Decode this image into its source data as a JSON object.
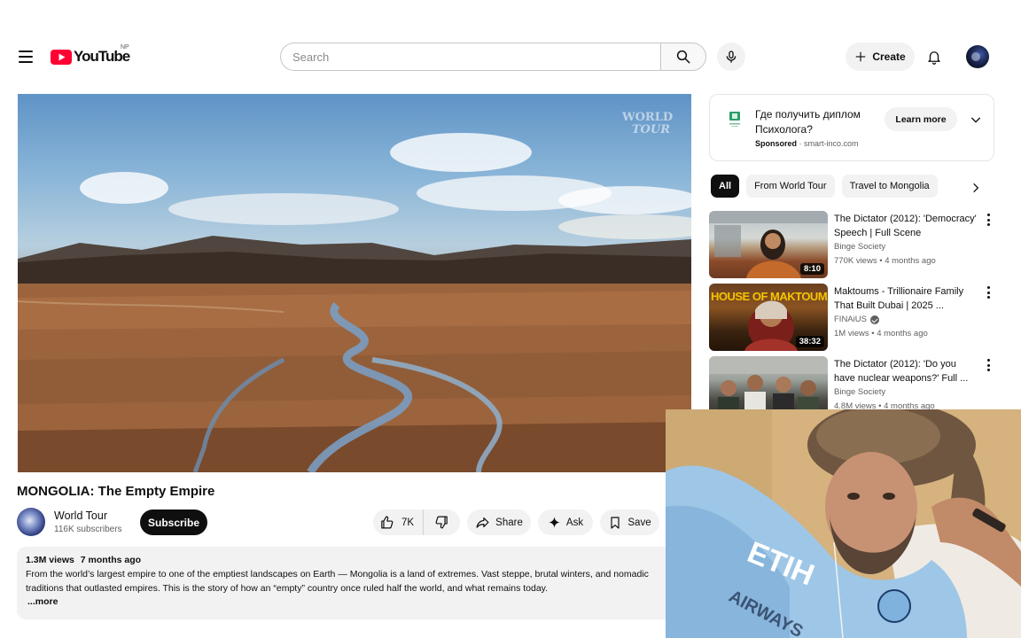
{
  "header": {
    "logo_text": "YouTube",
    "country_code": "NP",
    "search_placeholder": "Search",
    "create_label": "Create"
  },
  "player": {
    "watermark_line1": "WORLD",
    "watermark_line2": "TOUR"
  },
  "video": {
    "title": "MONGOLIA: The Empty Empire",
    "channel_name": "World Tour",
    "channel_subs": "116K subscribers",
    "subscribe_label": "Subscribe",
    "like_count": "7K",
    "share_label": "Share",
    "ask_label": "Ask",
    "save_label": "Save"
  },
  "description": {
    "views": "1.3M views",
    "age": "7 months ago",
    "text": "From the world’s largest empire to one of the emptiest landscapes on Earth — Mongolia is a land of extremes. Vast steppe, brutal winters, and nomadic traditions that outlasted empires. This is the story of how an “empty” country once ruled half the world, and what remains today.",
    "more_label": "...more"
  },
  "ad": {
    "title": "Где получить диплом Психолога?",
    "sponsored": "Sponsored",
    "domain": "smart-inco.com",
    "learn_more": "Learn more"
  },
  "chips": [
    "All",
    "From World Tour",
    "Travel to Mongolia"
  ],
  "recommendations": [
    {
      "title": "The Dictator (2012): 'Democracy' Speech | Full Scene",
      "channel": "Binge Society",
      "verified": false,
      "views": "770K views",
      "age": "4 months ago",
      "duration": "8:10",
      "thumb_caption": "HOUSE OF MAKTOUM"
    },
    {
      "title": "Maktoums - Trillionaire Family That Built Dubai | 2025 ...",
      "channel": "FINAiUS",
      "verified": true,
      "views": "1M views",
      "age": "4 months ago",
      "duration": "38:32"
    },
    {
      "title": "The Dictator (2012): 'Do you have nuclear weapons?' Full ...",
      "channel": "Binge Society",
      "verified": false,
      "views": "4.8M views",
      "age": "4 months ago",
      "duration": ""
    }
  ],
  "colors": {
    "youtube_red": "#ff0033",
    "text_primary": "#0f0f0f",
    "text_secondary": "#606060",
    "chip_bg": "#f2f2f2"
  }
}
